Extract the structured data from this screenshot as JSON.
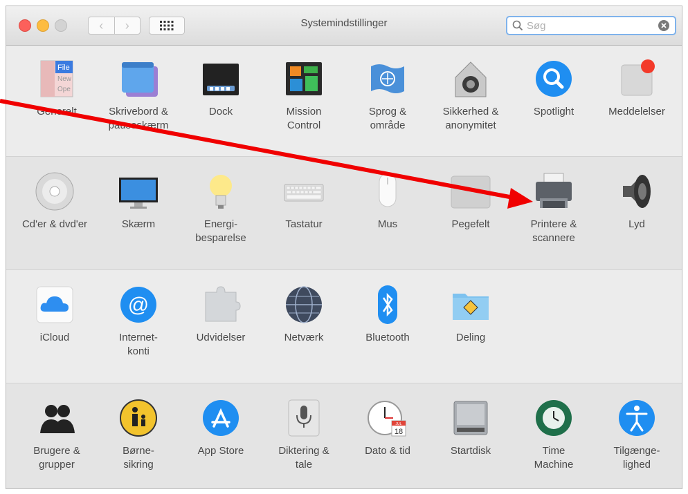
{
  "window": {
    "title": "Systemindstillinger",
    "search": {
      "placeholder": "Søg",
      "value": ""
    }
  },
  "toolbar": {
    "back_glyph": "‹",
    "forward_glyph": "›"
  },
  "sections": [
    {
      "items": [
        {
          "label": "Generelt",
          "icon": "general-icon",
          "file_text": [
            "File",
            "New",
            "Ope"
          ]
        },
        {
          "label": "Skrivebord &\npauseskærm",
          "icon": "desktop-icon"
        },
        {
          "label": "Dock",
          "icon": "dock-icon"
        },
        {
          "label": "Mission\nControl",
          "icon": "mission-control-icon"
        },
        {
          "label": "Sprog &\nområde",
          "icon": "language-flag-icon"
        },
        {
          "label": "Sikkerhed &\nanonymitet",
          "icon": "security-house-icon"
        },
        {
          "label": "Spotlight",
          "icon": "spotlight-icon"
        },
        {
          "label": "Meddelelser",
          "icon": "notifications-icon"
        }
      ]
    },
    {
      "items": [
        {
          "label": "Cd'er & dvd'er",
          "icon": "cd-dvd-icon"
        },
        {
          "label": "Skærm",
          "icon": "display-icon"
        },
        {
          "label": "Energi-\nbesparelse",
          "icon": "energy-bulb-icon"
        },
        {
          "label": "Tastatur",
          "icon": "keyboard-icon"
        },
        {
          "label": "Mus",
          "icon": "mouse-icon"
        },
        {
          "label": "Pegefelt",
          "icon": "trackpad-icon"
        },
        {
          "label": "Printere &\nscannere",
          "icon": "printer-icon"
        },
        {
          "label": "Lyd",
          "icon": "speaker-icon"
        }
      ]
    },
    {
      "items": [
        {
          "label": "iCloud",
          "icon": "icloud-icon"
        },
        {
          "label": "Internet-\nkonti",
          "icon": "internet-accounts-icon"
        },
        {
          "label": "Udvidelser",
          "icon": "extensions-icon"
        },
        {
          "label": "Netværk",
          "icon": "network-globe-icon"
        },
        {
          "label": "Bluetooth",
          "icon": "bluetooth-icon"
        },
        {
          "label": "Deling",
          "icon": "sharing-folder-icon"
        }
      ]
    },
    {
      "items": [
        {
          "label": "Brugere &\ngrupper",
          "icon": "users-groups-icon"
        },
        {
          "label": "Børne-\nsikring",
          "icon": "parental-controls-icon"
        },
        {
          "label": "App Store",
          "icon": "app-store-icon"
        },
        {
          "label": "Diktering &\ntale",
          "icon": "dictation-mic-icon"
        },
        {
          "label": "Dato & tid",
          "icon": "date-time-icon",
          "calendar_day": "18",
          "calendar_month": "JUL"
        },
        {
          "label": "Startdisk",
          "icon": "startup-disk-icon"
        },
        {
          "label": "Time\nMachine",
          "icon": "time-machine-icon"
        },
        {
          "label": "Tilgænge-\nlighed",
          "icon": "accessibility-icon"
        }
      ]
    }
  ],
  "colors": {
    "annotation_arrow": "#f00000",
    "search_focus": "#7fb3ec"
  }
}
